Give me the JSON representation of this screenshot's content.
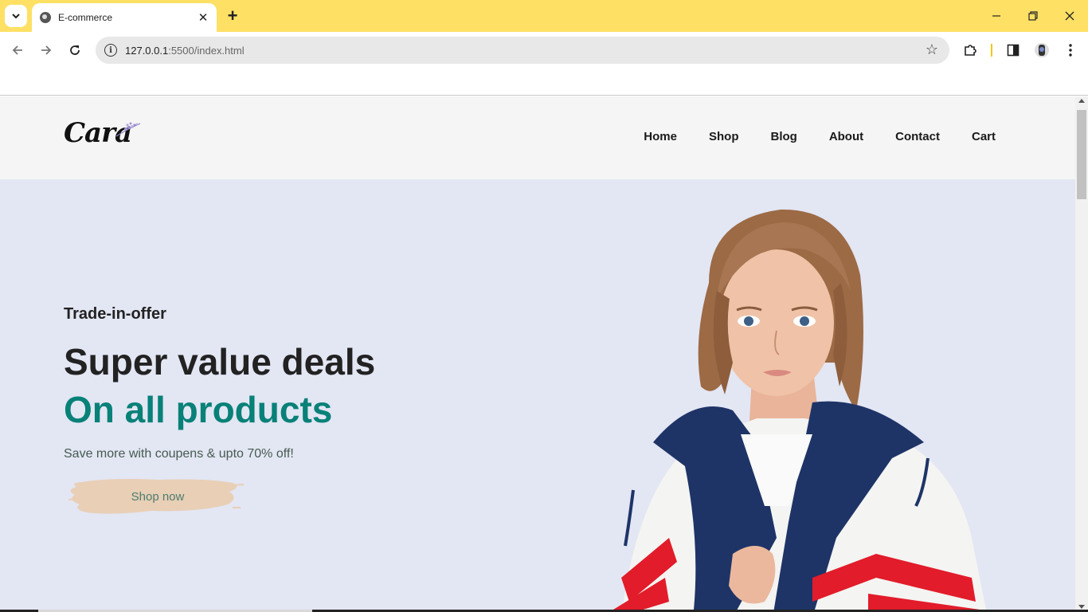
{
  "browser": {
    "tab_title": "E-commerce",
    "url_host": "127.0.0.1",
    "url_path": ":5500/index.html",
    "tab_bar_color": "#FEE064"
  },
  "site": {
    "logo_text": "Cara",
    "nav": [
      "Home",
      "Shop",
      "Blog",
      "About",
      "Contact",
      "Cart"
    ]
  },
  "hero": {
    "kicker": "Trade-in-offer",
    "title": "Super value deals",
    "title_accent": "On all products",
    "subtitle": "Save more with coupens & upto 70% off!",
    "button_label": "Shop now",
    "accent_color": "#088178",
    "background_color": "#E3E6F3"
  }
}
